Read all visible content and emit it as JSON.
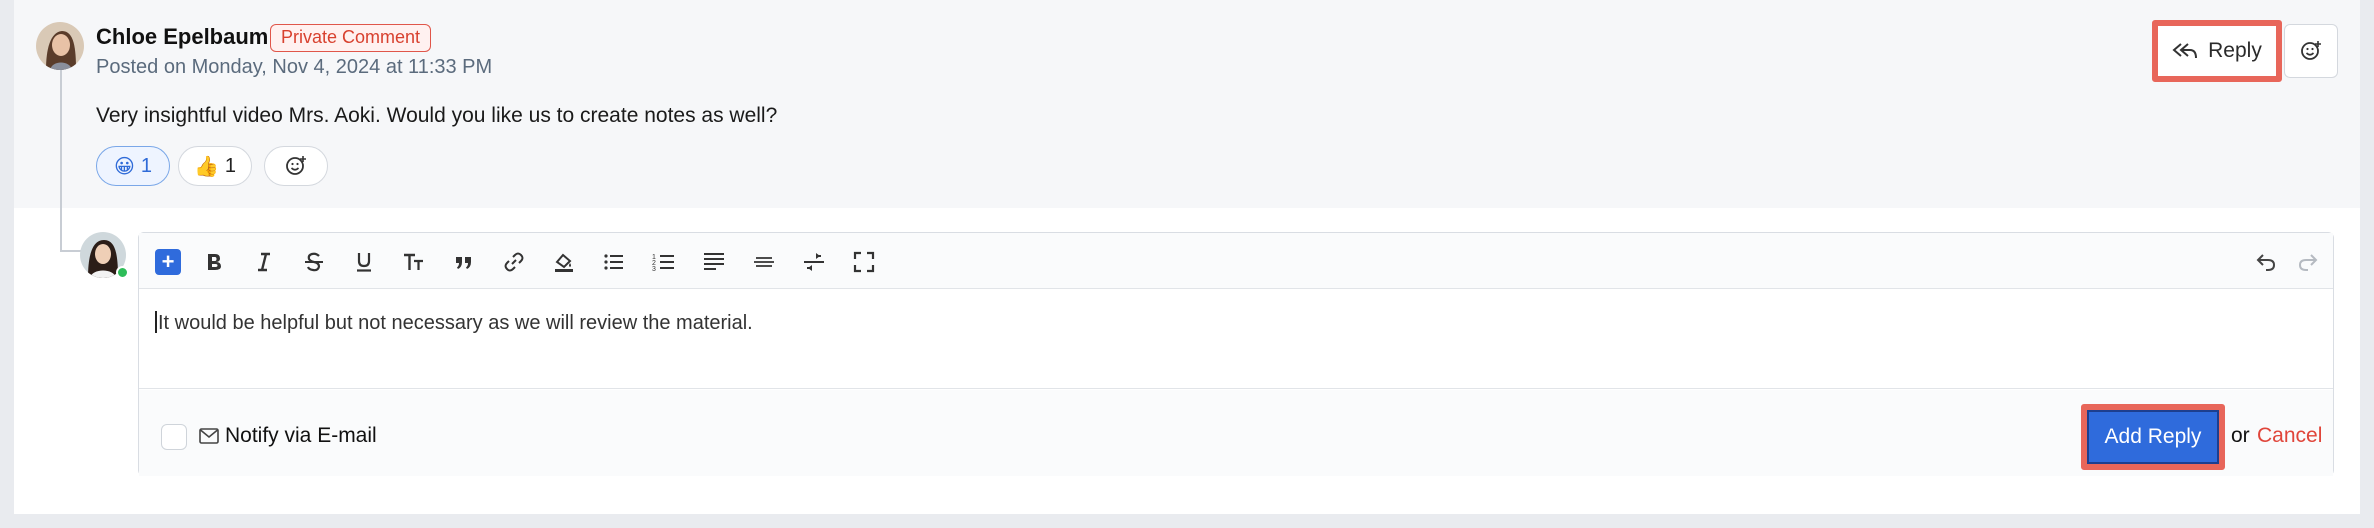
{
  "comment": {
    "author": "Chloe Epelbaum",
    "badge": "Private Comment",
    "posted_on": "Posted on Monday, Nov 4, 2024 at 11:33 PM",
    "text": "Very insightful video Mrs. Aoki. Would you like us to create notes as well?",
    "reactions": [
      {
        "emoji": "😀",
        "count": "1",
        "selected": true
      },
      {
        "emoji": "👍",
        "count": "1",
        "selected": false
      }
    ],
    "reply_label": "Reply"
  },
  "editor": {
    "text": "It would be helpful but not necessary as we will review the material.",
    "toolbar": [
      "insert",
      "bold",
      "italic",
      "strikethrough",
      "underline",
      "text-size",
      "quote",
      "link",
      "highlight",
      "bulleted-list",
      "numbered-list",
      "align",
      "horizontal-rule",
      "merge",
      "fullscreen",
      "undo",
      "redo"
    ]
  },
  "footer": {
    "notify_label": "Notify via E-mail",
    "add_reply_label": "Add Reply",
    "or_text": "or",
    "cancel_label": "Cancel"
  },
  "colors": {
    "accent": "#2f6bdc",
    "highlight_border": "#e8665a",
    "cancel": "#e0453a",
    "badge": "#d8412f"
  }
}
